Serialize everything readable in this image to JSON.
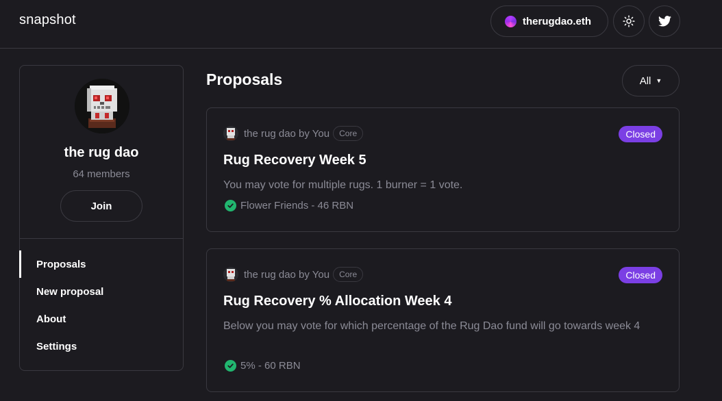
{
  "header": {
    "logo": "snapshot",
    "account": "therugdao.eth",
    "theme_icon": "sun-icon",
    "twitter_icon": "twitter-icon"
  },
  "sidebar": {
    "space_name": "the rug dao",
    "members": "64 members",
    "join_label": "Join",
    "nav": [
      {
        "label": "Proposals",
        "active": true
      },
      {
        "label": "New proposal",
        "active": false
      },
      {
        "label": "About",
        "active": false
      },
      {
        "label": "Settings",
        "active": false
      }
    ]
  },
  "main": {
    "title": "Proposals",
    "filter_label": "All",
    "proposals": [
      {
        "author": "the rug dao by You",
        "badge": "Core",
        "status": "Closed",
        "title": "Rug Recovery Week 5",
        "body": "You may vote for multiple rugs. 1 burner = 1 vote.",
        "result": "Flower Friends - 46 RBN"
      },
      {
        "author": "the rug dao by You",
        "badge": "Core",
        "status": "Closed",
        "title": "Rug Recovery % Allocation Week 4",
        "body": "Below you may vote for which percentage of the Rug Dao fund will go towards week 4",
        "result": "5% - 60 RBN"
      }
    ]
  },
  "colors": {
    "background": "#1c1b20",
    "border": "#3a3940",
    "muted_text": "#8b8b96",
    "closed_badge": "#7b3fe4",
    "success": "#21b66f"
  }
}
